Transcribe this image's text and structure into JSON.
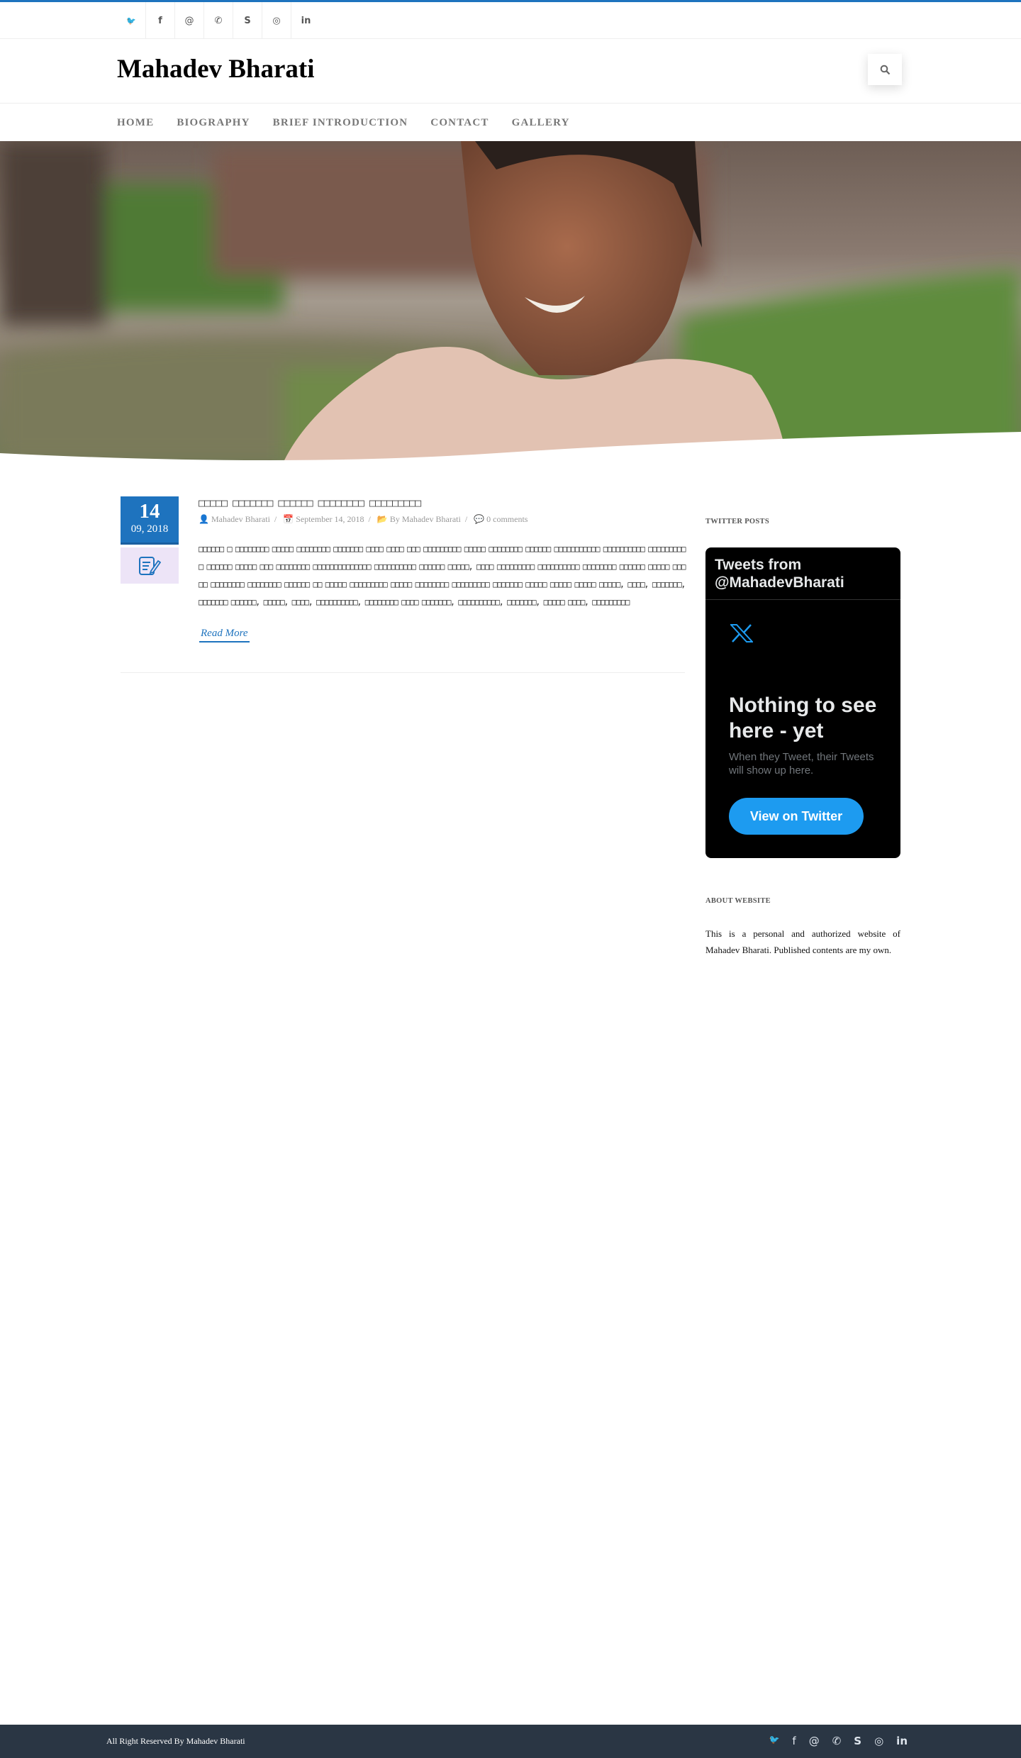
{
  "social": [
    {
      "icon": "twitter-icon",
      "glyph": "🐦"
    },
    {
      "icon": "facebook-icon",
      "glyph": "f"
    },
    {
      "icon": "at-icon",
      "glyph": "@"
    },
    {
      "icon": "phone-icon",
      "glyph": "✆"
    },
    {
      "icon": "skype-icon",
      "glyph": "S"
    },
    {
      "icon": "instagram-icon",
      "glyph": "◎"
    },
    {
      "icon": "linkedin-icon",
      "glyph": "in"
    }
  ],
  "header": {
    "title": "Mahadev Bharati"
  },
  "nav": [
    "HOME",
    "BIOGRAPHY",
    "BRIEF INTRODUCTION",
    "CONTACT",
    "GALLERY"
  ],
  "post": {
    "day": "14",
    "month_year": "09, 2018",
    "title": "□□□□□ □□□□□□□ □□□□□□ □□□□□□□□ □□□□□□□□□",
    "author": "Mahadev Bharati",
    "date": "September 14, 2018",
    "category": "By Mahadev Bharati",
    "comments": "0 comments",
    "body": "□□□□□□ □ □□□□□□□□ □□□□□ □□□□□□□□ □□□□□□□ □□□□ □□□□ □□□ □□□□□□□□□ □□□□□ □□□□□□□□ □□□□□□ □□□□□□□□□□□ □□□□□□□□□□ □□□□□□□□□□ □□□□□□ □□□□□ □□□ □□□□□□□□ □□□□□□□□□□□□□□ □□□□□□□□□□ □□□□□□ □□□□□, □□□□ □□□□□□□□□ □□□□□□□□□□ □□□□□□□□ □□□□□□ □□□□□ □□□□□ □□□□□□□□ □□□□□□□□ □□□□□□ □□ □□□□□ □□□□□□□□□ □□□□□ □□□□□□□□ □□□□□□□□□ □□□□□□□ □□□□□ □□□□□ □□□□□ □□□□□, □□□□, □□□□□□□, □□□□□□□ □□□□□□, □□□□□, □□□□, □□□□□□□□□□, □□□□□□□□ □□□□ □□□□□□□, □□□□□□□□□□, □□□□□□□, □□□□□ □□□□, □□□□□□□□□",
    "read_more": "Read More"
  },
  "sidebar": {
    "twitter_label": "TWITTER POSTS",
    "tw_header": "Tweets from @MahadevBharati",
    "tw_empty": "Nothing to see here - yet",
    "tw_sub": "When they Tweet, their Tweets will show up here.",
    "tw_button": "View on Twitter",
    "about_label": "ABOUT WEBSITE",
    "about_text": "This is a personal and authorized website of Mahadev Bharati. Published contents are my own."
  },
  "footer": {
    "copyright": "All Right Reserved By Mahadev Bharati"
  },
  "colors": {
    "accent": "#1e73be",
    "footer": "#2a3644",
    "twitter_blue": "#1d9bf0"
  }
}
